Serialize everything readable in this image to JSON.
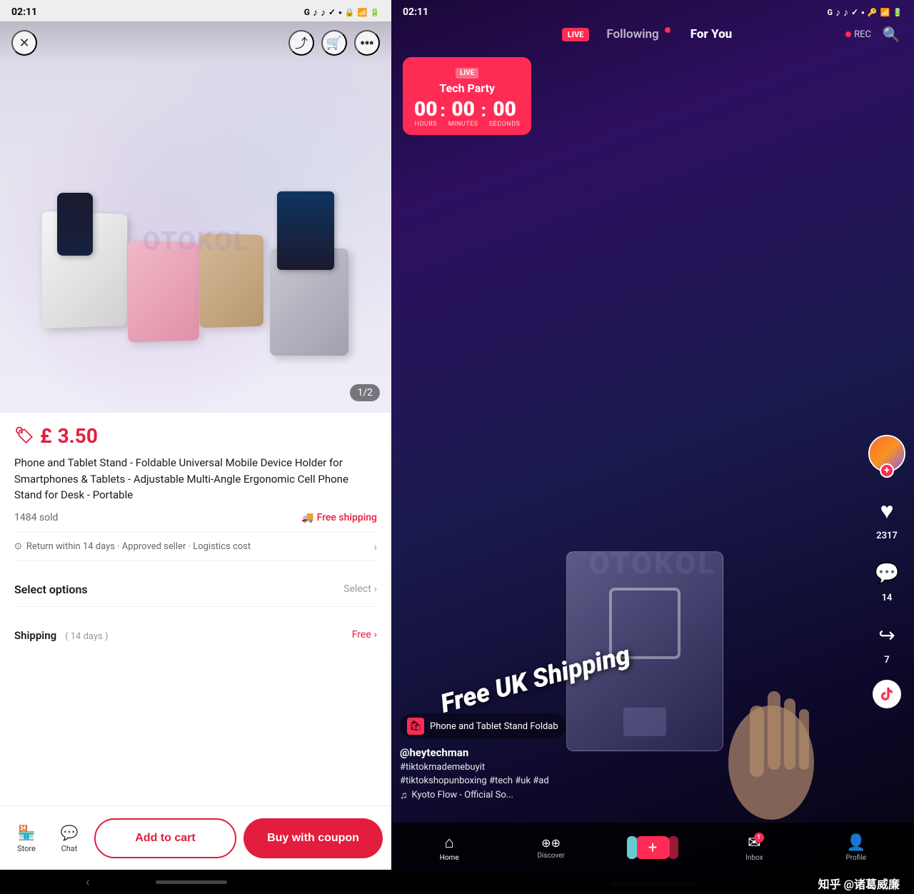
{
  "left": {
    "status": {
      "time": "02:11",
      "icons": [
        "G",
        "tiktok1",
        "tiktok2",
        "check",
        "dot"
      ]
    },
    "image": {
      "counter": "1/2"
    },
    "product": {
      "currency": "£",
      "price": "3.50",
      "title": "Phone and Tablet Stand - Foldable Universal Mobile Device Holder for Smartphones & Tablets - Adjustable Multi-Angle Ergonomic Cell Phone Stand for Desk - Portable",
      "sold": "1484 sold",
      "free_shipping": "Free shipping",
      "return_policy": "Return within 14 days · Approved seller · Logistics cost",
      "select_options": "Select options",
      "select_action": "Select",
      "shipping_label": "Shipping",
      "shipping_days": "( 14 days )",
      "shipping_free": "Free"
    },
    "actions": {
      "store_label": "Store",
      "chat_label": "Chat",
      "add_to_cart": "Add to cart",
      "buy_with_coupon": "Buy with coupon"
    }
  },
  "right": {
    "status": {
      "time": "02:11",
      "icons": [
        "G",
        "tiktok1",
        "tiktok2",
        "check",
        "dot"
      ]
    },
    "nav": {
      "live_label": "LIVE",
      "following": "Following",
      "for_you": "For You",
      "rec": "REC"
    },
    "countdown": {
      "live_badge": "LIVE",
      "title": "Tech Party",
      "hours": "00",
      "minutes": "00",
      "seconds": "00",
      "hours_label": "HOURS",
      "minutes_label": "MINUTES",
      "seconds_label": "SECONDS"
    },
    "overlay": {
      "free_shipping_text": "Free UK Shipping"
    },
    "product_tag": {
      "name": "Phone and Tablet Stand  Foldab"
    },
    "video_info": {
      "username": "@heytechman",
      "hashtags": "#tiktokmademebuyit",
      "hashtags2": "#tiktokshopunboxing #tech #uk #ad",
      "music": "Kyoto Flow - Official So..."
    },
    "actions": {
      "like_count": "2317",
      "comment_count": "14",
      "share_count": "7"
    },
    "bottom_nav": {
      "home": "Home",
      "discover": "Discover",
      "inbox": "Inbox",
      "inbox_badge": "1",
      "profile": "Profile"
    },
    "watermark": "知乎 @诸葛威廉"
  },
  "icons": {
    "close": "✕",
    "share": "↗",
    "cart": "🛒",
    "more": "⋯",
    "shield": "⊙",
    "chevron_right": "›",
    "truck": "🚚",
    "home_icon": "⌂",
    "store_icon": "🏪",
    "chat_icon": "💬",
    "heart": "♥",
    "comment": "💬",
    "forward": "↪",
    "search": "🔍",
    "music_note": "♫",
    "plus": "+"
  }
}
